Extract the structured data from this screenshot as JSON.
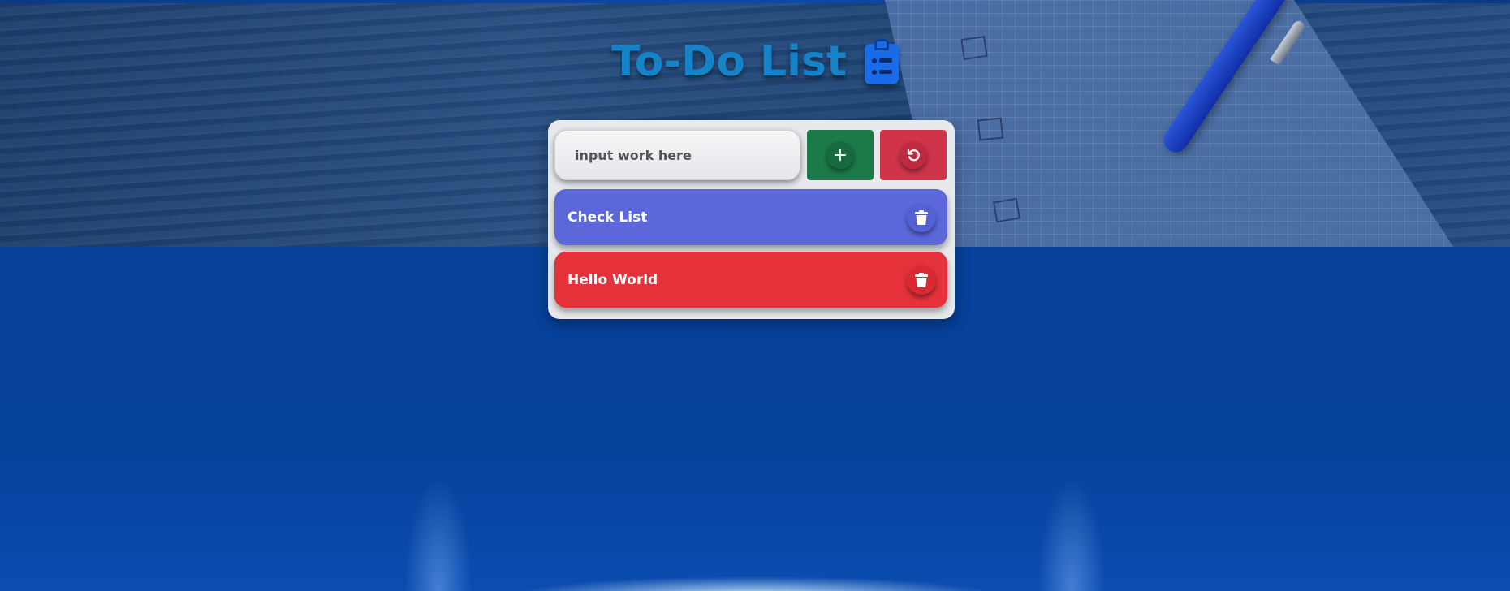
{
  "app": {
    "title": "To-Do List",
    "title_icon": "clipboard-list-icon"
  },
  "form": {
    "input_placeholder": "input work here",
    "input_value": "",
    "add_button_icon": "plus-icon",
    "add_button_glyph": "+",
    "reset_button_icon": "rotate-ccw-icon"
  },
  "tasks": [
    {
      "label": "Check List",
      "color": "#5c68da",
      "delete_icon": "trash-icon"
    },
    {
      "label": "Hello World",
      "color": "#e5323a",
      "delete_icon": "trash-icon"
    }
  ],
  "colors": {
    "title": "#1683c8",
    "add_button": "#1c7a4a",
    "reset_button": "#d0344b",
    "card": "#e8e9ec",
    "page_background": "#04439a"
  }
}
